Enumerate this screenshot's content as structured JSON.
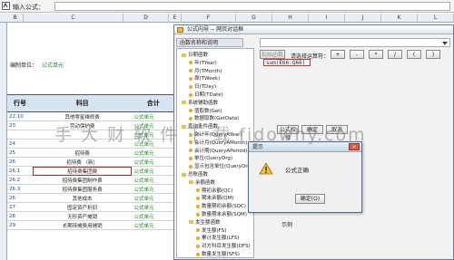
{
  "formula_bar": {
    "label": "输入公式：",
    "value": ""
  },
  "columns": [
    "B",
    "C",
    "D",
    "E",
    "F",
    "G",
    "H",
    "I",
    "J",
    "K",
    "L"
  ],
  "sheet": {
    "unit_label": "编制单位：",
    "unit_value": "公式单元",
    "header": {
      "col1": "行号",
      "col2": "科目",
      "col3": "合计"
    },
    "rows": [
      {
        "code": "22.10",
        "name": "其他零星维修费",
        "total": "公式单元"
      },
      {
        "code": "23",
        "name": "劳动保护费",
        "total": "公式单元"
      },
      {
        "code": "",
        "name": "",
        "total": "公式单元"
      },
      {
        "code": "24",
        "name": "",
        "total": "公式单元"
      },
      {
        "code": "25",
        "name": "招待费",
        "total": "公式单元"
      },
      {
        "code": "26",
        "name": "招待费   （新）",
        "total": "公式单元"
      },
      {
        "code": "26.1",
        "name": "招待费集团费",
        "total": "公式单元"
      },
      {
        "code": "26.2",
        "name": "招待费集团制作费",
        "total": "公式单元"
      },
      {
        "code": "26.3",
        "name": "招待费集团服务费",
        "total": "公式单元"
      },
      {
        "code": "26",
        "name": "其他成本",
        "total": "公式单元"
      },
      {
        "code": "27",
        "name": "固定资产折旧",
        "total": "公式单元"
      },
      {
        "code": "28",
        "name": "无形资产摊销",
        "total": "公式单元"
      },
      {
        "code": "29",
        "name": "长期待摊费用摊销",
        "total": "公式单元"
      }
    ],
    "selected_row": 6
  },
  "dialog": {
    "title": "公式向导 -- 网页对话框",
    "func_header": "函数名称和说明",
    "paste_button": "粘贴函数",
    "operator_label": "请选择运算符：",
    "operators": [
      "+",
      "-",
      "*",
      "/",
      "(",
      ")"
    ],
    "expression": "sum(E66:Q66)",
    "buttons": {
      "verify": "公式校验",
      "ok": "确定",
      "cancel": "取消"
    },
    "example_label": "示例",
    "tree": [
      {
        "type": "folder",
        "label": "日期函数",
        "depth": 0
      },
      {
        "type": "item",
        "label": "年(TYear)",
        "depth": 1
      },
      {
        "type": "item",
        "label": "月(TMonth)",
        "depth": 1
      },
      {
        "type": "item",
        "label": "周(TWeek)",
        "depth": 1
      },
      {
        "type": "item",
        "label": "日(TDay)",
        "depth": 1
      },
      {
        "type": "item",
        "label": "日期(TDate)",
        "depth": 1
      },
      {
        "type": "folder",
        "label": "系统辅助函数",
        "depth": 0
      },
      {
        "type": "item",
        "label": "值取数(Get)",
        "depth": 1
      },
      {
        "type": "item",
        "label": "数据取数(GetData)",
        "depth": 1
      },
      {
        "type": "folder",
        "label": "查询条件函数",
        "depth": 0
      },
      {
        "type": "item",
        "label": "会计年(QueryAYear)",
        "depth": 1
      },
      {
        "type": "item",
        "label": "会计月(QueryAMonth)",
        "depth": 1
      },
      {
        "type": "item",
        "label": "会计期(QueryAPeriod)",
        "depth": 1
      },
      {
        "type": "item",
        "label": "单位(QueryOrg)",
        "depth": 1
      },
      {
        "type": "item",
        "label": "显示包含单位(QueryOrgs)",
        "depth": 1
      },
      {
        "type": "folder",
        "label": "总账函数",
        "depth": 0
      },
      {
        "type": "folder",
        "label": "余额函数",
        "depth": 1
      },
      {
        "type": "item",
        "label": "期初余额(QC)",
        "depth": 2
      },
      {
        "type": "item",
        "label": "期末余额(QM)",
        "depth": 2
      },
      {
        "type": "item",
        "label": "数量期初余额(SQC)",
        "depth": 2
      },
      {
        "type": "item",
        "label": "数量期末余额(SQM)",
        "depth": 2
      },
      {
        "type": "folder",
        "label": "发生额函数",
        "depth": 1
      },
      {
        "type": "item",
        "label": "发生额(FS)",
        "depth": 2
      },
      {
        "type": "item",
        "label": "累计发生额(LFS)",
        "depth": 2
      },
      {
        "type": "item",
        "label": "对方科目发生额(DFS)",
        "depth": 2
      },
      {
        "type": "item",
        "label": "数量发生额(SFS)",
        "depth": 2
      }
    ]
  },
  "alert": {
    "title": "提示",
    "close": "×",
    "message": "公式正确",
    "ok_label": "确定(O)"
  },
  "watermark": "手 大 财 软 件 下 载    fidowhy.com"
}
